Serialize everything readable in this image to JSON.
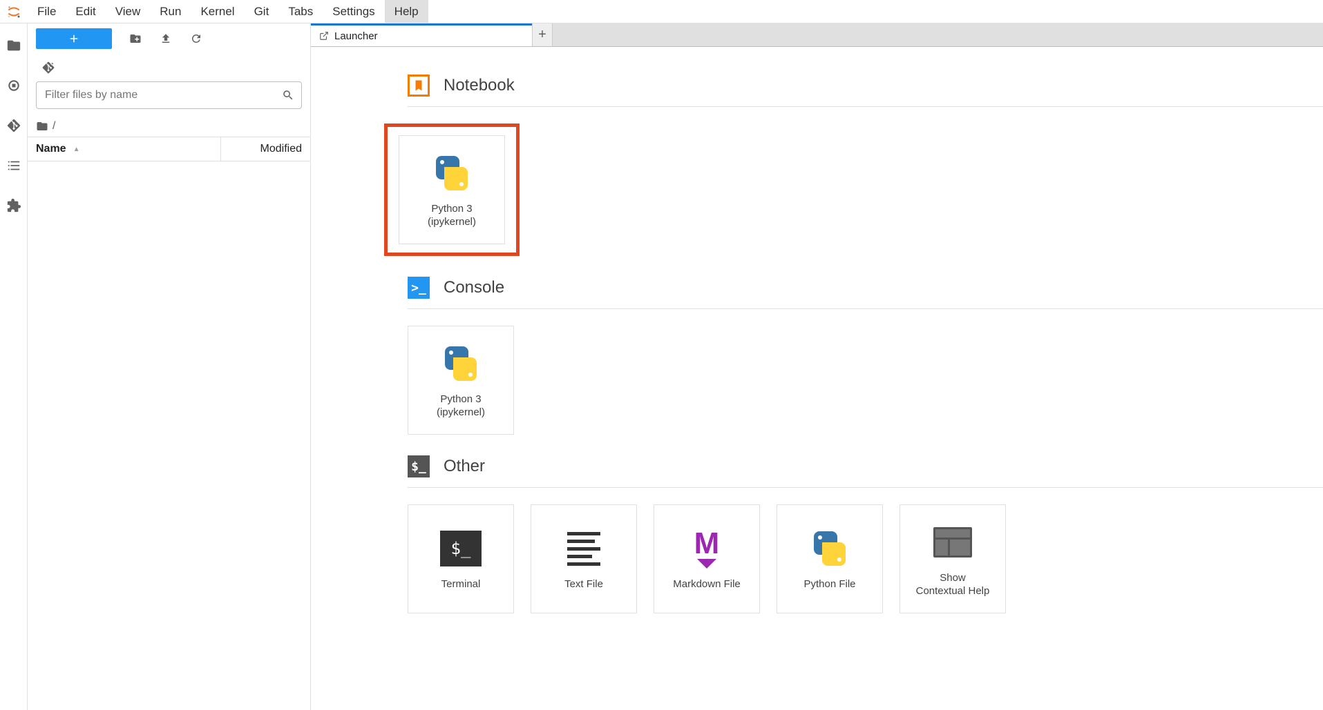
{
  "menubar": {
    "items": [
      "File",
      "Edit",
      "View",
      "Run",
      "Kernel",
      "Git",
      "Tabs",
      "Settings",
      "Help"
    ],
    "hovered_index": 8
  },
  "file_panel": {
    "filter_placeholder": "Filter files by name",
    "breadcrumb": "/",
    "columns": {
      "name": "Name",
      "modified": "Modified"
    }
  },
  "tabs": {
    "active": {
      "title": "Launcher"
    }
  },
  "launcher": {
    "sections": [
      {
        "title": "Notebook",
        "kind": "notebook",
        "cards": [
          {
            "label": "Python 3\n(ipykernel)",
            "icon": "python",
            "highlighted": true
          }
        ]
      },
      {
        "title": "Console",
        "kind": "console",
        "cards": [
          {
            "label": "Python 3\n(ipykernel)",
            "icon": "python"
          }
        ]
      },
      {
        "title": "Other",
        "kind": "other",
        "cards": [
          {
            "label": "Terminal",
            "icon": "terminal"
          },
          {
            "label": "Text File",
            "icon": "textfile"
          },
          {
            "label": "Markdown File",
            "icon": "markdown"
          },
          {
            "label": "Python File",
            "icon": "python"
          },
          {
            "label": "Show\nContextual Help",
            "icon": "contexthelp"
          }
        ]
      }
    ]
  }
}
